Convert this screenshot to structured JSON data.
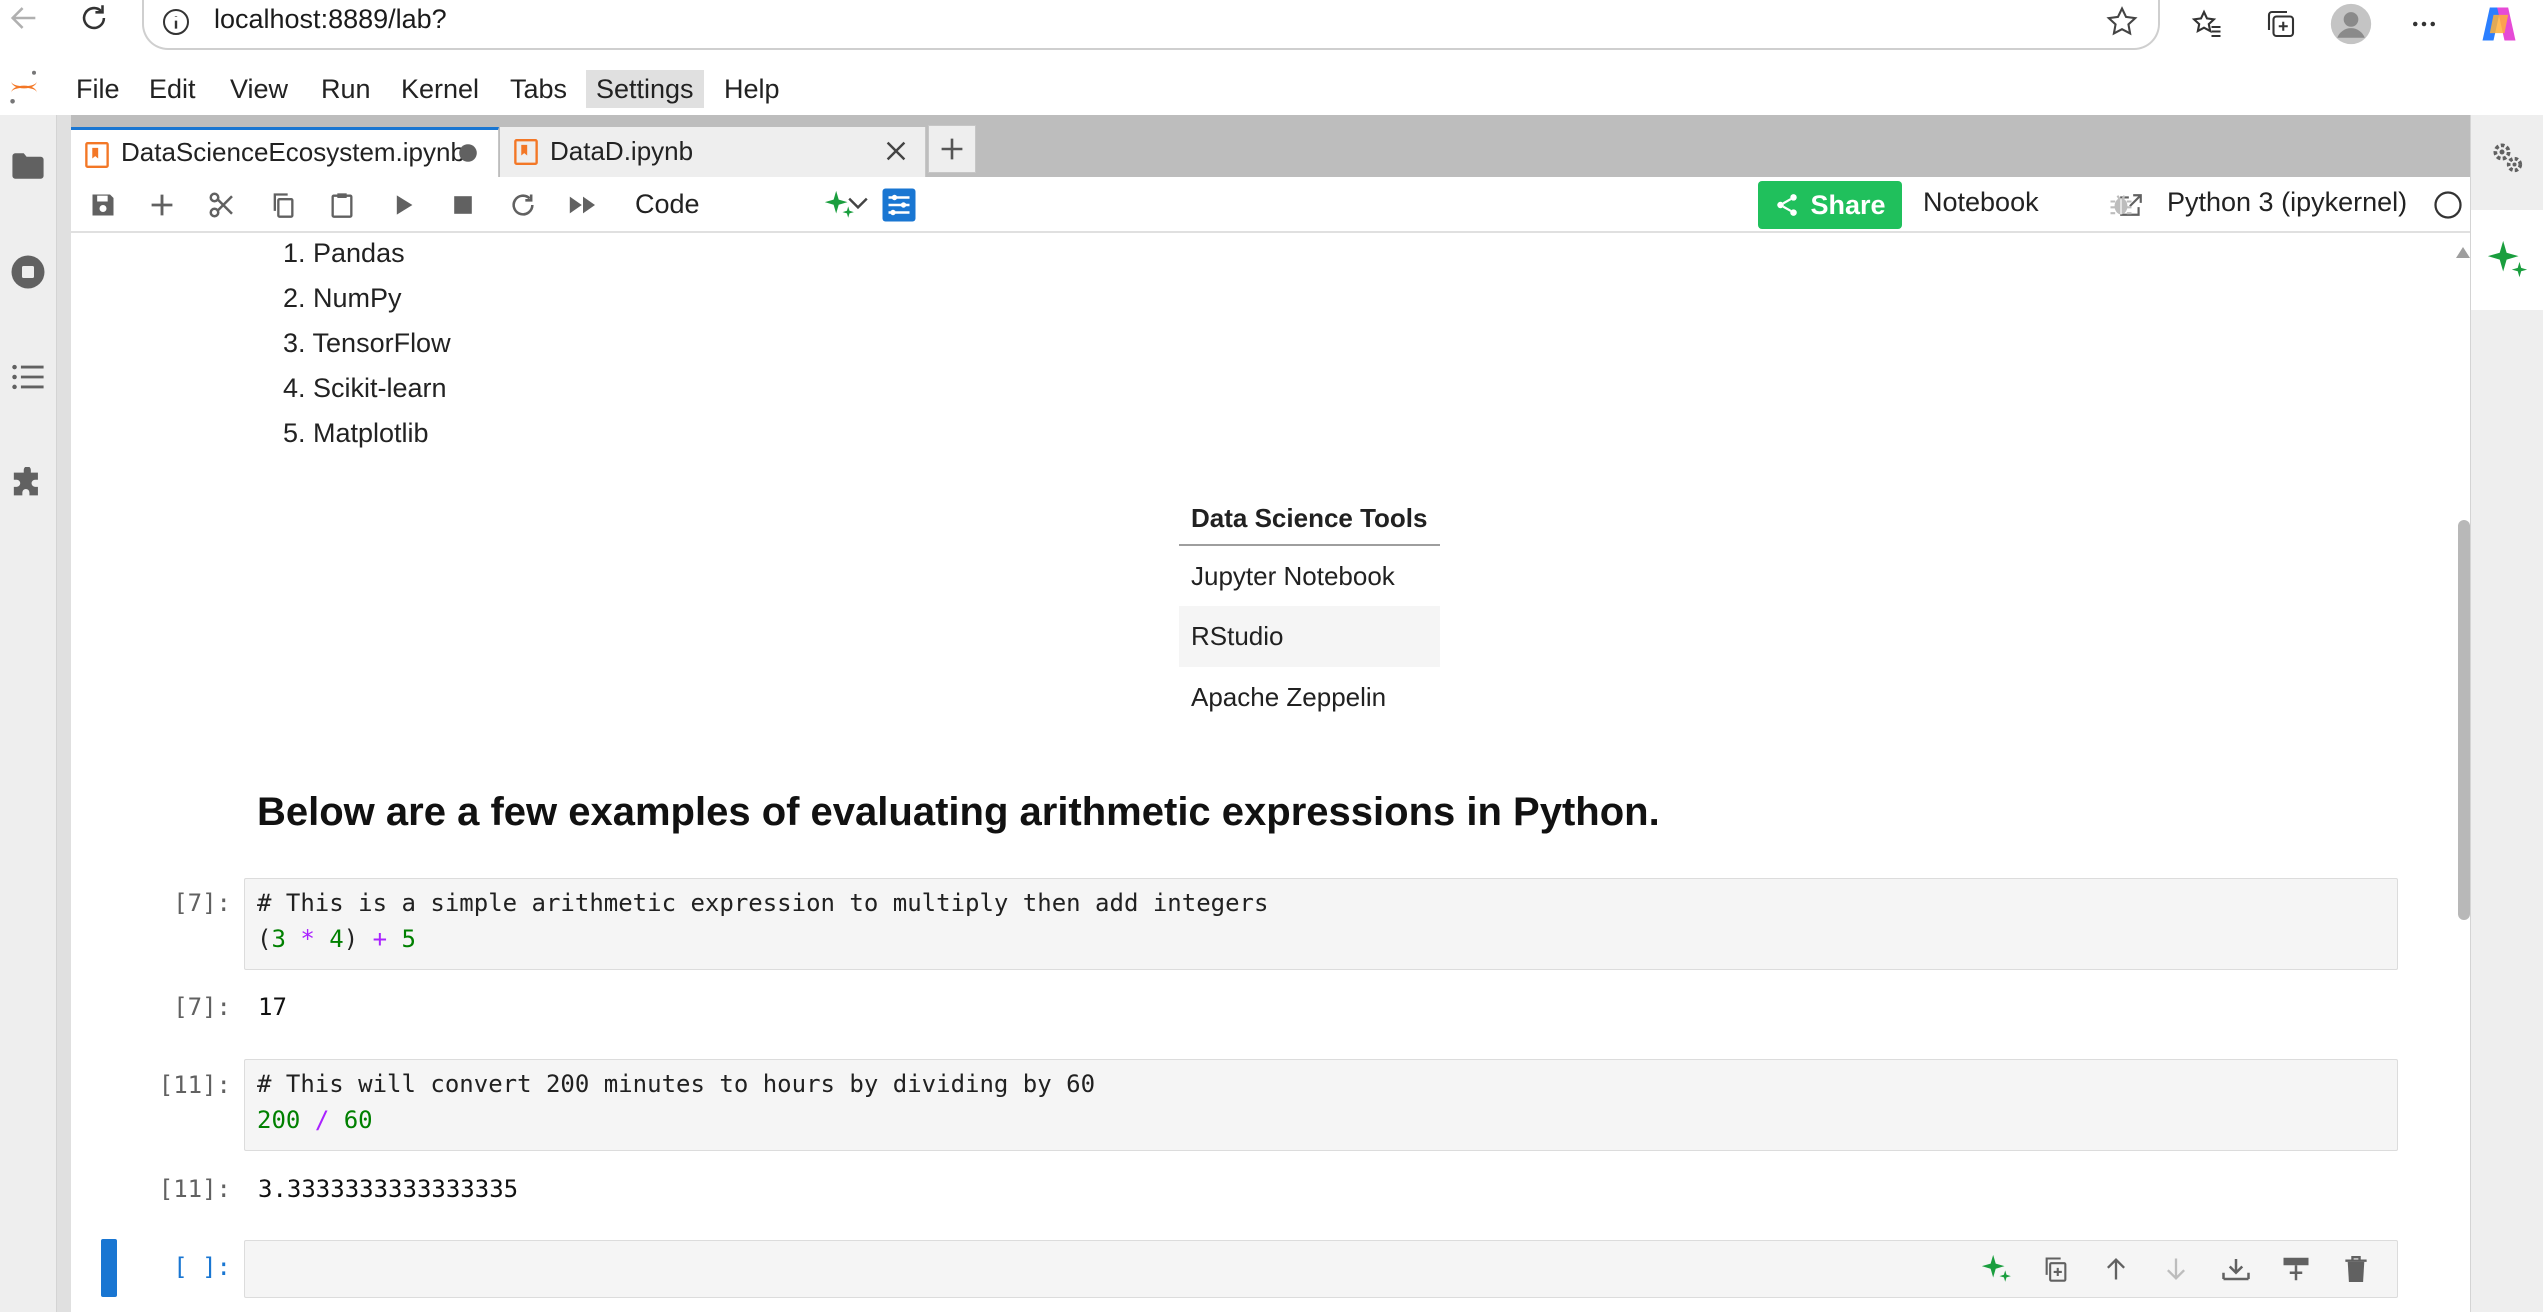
{
  "browser": {
    "url": "localhost:8889/lab?"
  },
  "menu": {
    "items": [
      "File",
      "Edit",
      "View",
      "Run",
      "Kernel",
      "Tabs",
      "Settings",
      "Help"
    ]
  },
  "tabs": [
    {
      "label": "DataScienceEcosystem.ipynb"
    },
    {
      "label": "DataD.ipynb"
    }
  ],
  "toolbar": {
    "cell_type": "Code",
    "share_label": "Share",
    "notebook_label": "Notebook",
    "kernel_label": "Python 3 (ipykernel)"
  },
  "notebook": {
    "library_list": [
      "1. Pandas",
      "2. NumPy",
      "3. TensorFlow",
      "4. Scikit-learn",
      "5. Matplotlib"
    ],
    "tools_table": {
      "header": "Data Science Tools",
      "rows": [
        "Jupyter Notebook",
        "RStudio",
        "Apache Zeppelin"
      ]
    },
    "heading": "Below are a few examples of evaluating arithmetic expressions in Python.",
    "cells": [
      {
        "in_prompt": "[7]:",
        "comment": "# This is a simple arithmetic expression to multiply then add integers",
        "out_prompt": "[7]:",
        "output": "17"
      },
      {
        "in_prompt": "[11]:",
        "comment": "# This will convert 200 minutes to hours by dividing by 60",
        "out_prompt": "[11]:",
        "output": "3.3333333333333335"
      }
    ],
    "empty_prompt": "[ ]:"
  }
}
